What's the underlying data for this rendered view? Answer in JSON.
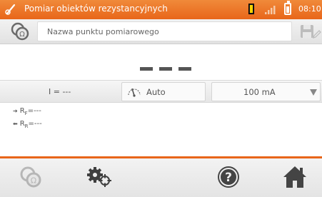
{
  "status_bar": {
    "title": "Pomiar obiektów rezystancyjnych",
    "time": "08:10",
    "icons": [
      "probe-icon",
      "sd-card-icon",
      "signal-icon",
      "battery-icon"
    ]
  },
  "header": {
    "point_name_placeholder": "Nazwa punktu pomiarowego",
    "icons": [
      "resistance-mode-icon",
      "pencil-icon",
      "save-icon"
    ]
  },
  "result": {
    "main_value": "---"
  },
  "params": {
    "current_label": "I = ---",
    "mode_label": "Auto",
    "range_value": "100 mA"
  },
  "sub_results": {
    "rf_label": "RF",
    "rf_value": "=---",
    "rr_label": "RR",
    "rr_value": "=---"
  },
  "toolbar": {
    "items": [
      "mode-icon",
      "settings-icon",
      "help-icon",
      "home-icon"
    ]
  },
  "colors": {
    "accent": "#e8661a",
    "text": "#555555",
    "toolbar_icon": "#444444"
  }
}
